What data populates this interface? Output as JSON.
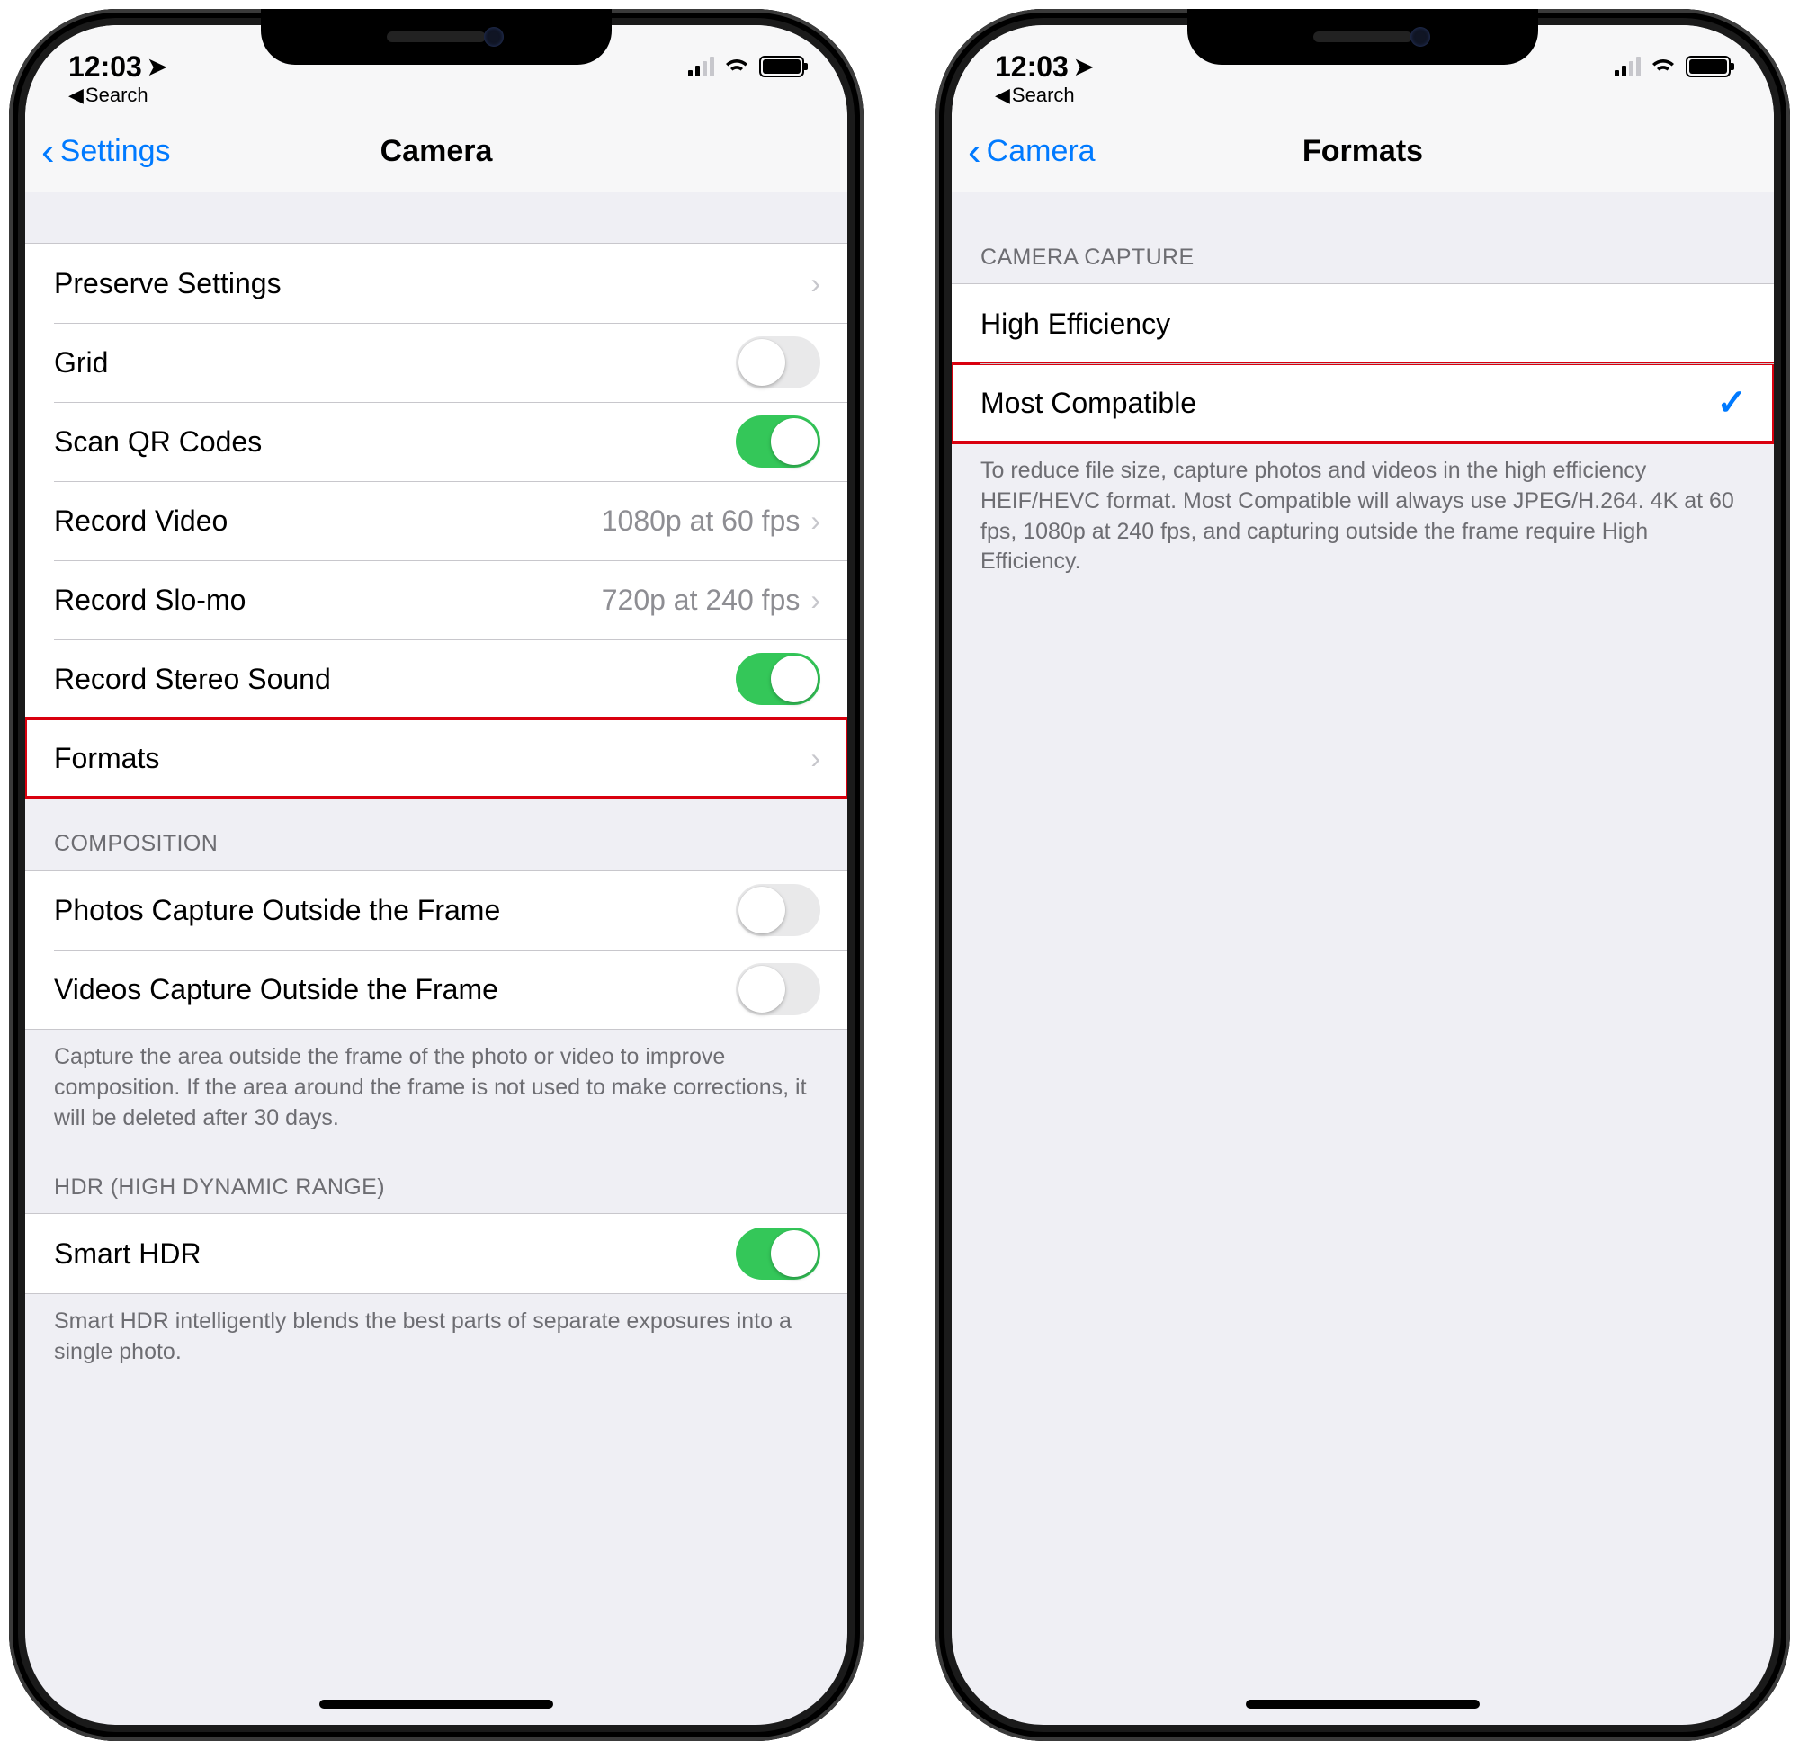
{
  "status": {
    "time": "12:03",
    "back_app": "Search"
  },
  "left": {
    "nav_back": "Settings",
    "nav_title": "Camera",
    "rows": {
      "preserve": "Preserve Settings",
      "grid": "Grid",
      "scan_qr": "Scan QR Codes",
      "rec_video": "Record Video",
      "rec_video_val": "1080p at 60 fps",
      "rec_slomo": "Record Slo-mo",
      "rec_slomo_val": "720p at 240 fps",
      "rec_stereo": "Record Stereo Sound",
      "formats": "Formats"
    },
    "composition": {
      "header": "COMPOSITION",
      "photos_outside": "Photos Capture Outside the Frame",
      "videos_outside": "Videos Capture Outside the Frame",
      "footer": "Capture the area outside the frame of the photo or video to improve composition. If the area around the frame is not used to make corrections, it will be deleted after 30 days."
    },
    "hdr": {
      "header": "HDR (HIGH DYNAMIC RANGE)",
      "smart_hdr": "Smart HDR",
      "footer": "Smart HDR intelligently blends the best parts of separate exposures into a single photo."
    }
  },
  "right": {
    "nav_back": "Camera",
    "nav_title": "Formats",
    "header": "CAMERA CAPTURE",
    "high_eff": "High Efficiency",
    "most_compat": "Most Compatible",
    "footer": "To reduce file size, capture photos and videos in the high efficiency HEIF/HEVC format. Most Compatible will always use JPEG/H.264. 4K at 60 fps, 1080p at 240 fps, and capturing outside the frame require High Efficiency."
  }
}
